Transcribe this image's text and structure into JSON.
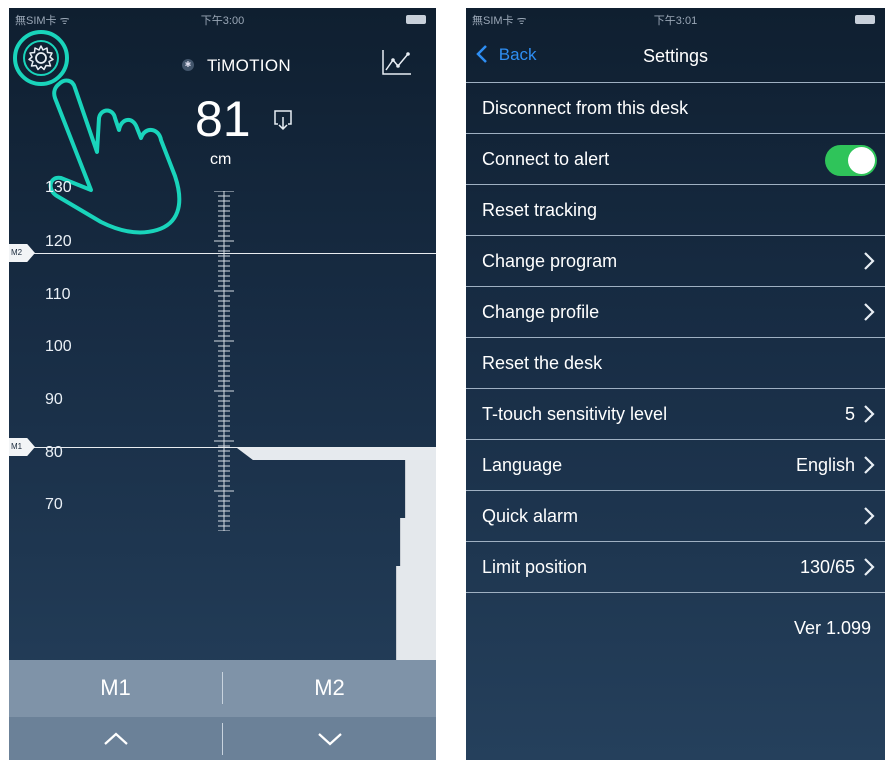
{
  "left_phone": {
    "status": {
      "carrier": "無SIM卡 ᯤ",
      "time": "下午3:00"
    },
    "brand": "TiMOTION",
    "height_value": "81",
    "height_unit": "cm",
    "scale_labels": [
      "130",
      "120",
      "110",
      "100",
      "90",
      "80",
      "70"
    ],
    "memory_flags": [
      "M2",
      "M1"
    ],
    "buttons": {
      "m1": "M1",
      "m2": "M2"
    },
    "icons": [
      "gear-icon",
      "bluetooth-icon",
      "chart-icon",
      "save-icon",
      "hand-pointer-icon",
      "chevron-up-icon",
      "chevron-down-icon"
    ],
    "accent_color": "#19d4bb"
  },
  "right_phone": {
    "status": {
      "carrier": "無SIM卡 ᯤ",
      "time": "下午3:01"
    },
    "nav": {
      "back": "Back",
      "title": "Settings"
    },
    "items": [
      {
        "label": "Disconnect from this desk",
        "value": "",
        "chevron": false
      },
      {
        "label": "Connect to alert",
        "value": "",
        "toggle": true
      },
      {
        "label": "Reset tracking",
        "value": "",
        "chevron": false
      },
      {
        "label": "Change program",
        "value": "",
        "chevron": true
      },
      {
        "label": "Change profile",
        "value": "",
        "chevron": true
      },
      {
        "label": "Reset the desk",
        "value": "",
        "chevron": false
      },
      {
        "label": "T-touch sensitivity level",
        "value": "5",
        "chevron": true
      },
      {
        "label": "Language",
        "value": "English",
        "chevron": true
      },
      {
        "label": "Quick alarm",
        "value": "",
        "chevron": true
      },
      {
        "label": "Limit position",
        "value": "130/65",
        "chevron": true
      }
    ],
    "version": "Ver 1.099",
    "toggle_color": "#2fc45a",
    "link_color": "#2e8ef3"
  }
}
